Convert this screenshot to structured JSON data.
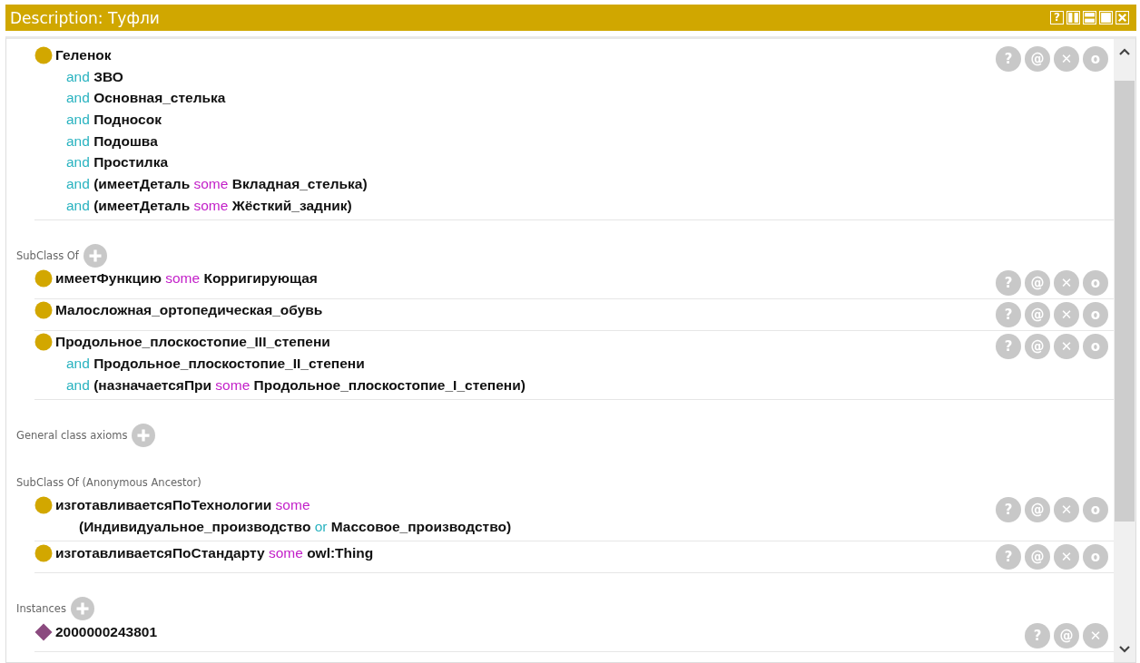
{
  "window": {
    "title": "Description: Туфли",
    "buttons": [
      {
        "kind": "help",
        "text": "?"
      },
      {
        "kind": "split-vertical"
      },
      {
        "kind": "split-horizontal"
      },
      {
        "kind": "maximize"
      },
      {
        "kind": "close"
      }
    ]
  },
  "sections": [
    {
      "entries": [
        {
          "kind": "class",
          "buttons": [
            "?",
            "@",
            "✕",
            "o"
          ],
          "lines": [
            [
              {
                "kind": "name",
                "text": "Геленок"
              }
            ],
            [
              {
                "kind": "and",
                "text": "and"
              },
              {
                "kind": "name",
                "text": "ЗВО"
              }
            ],
            [
              {
                "kind": "and",
                "text": "and"
              },
              {
                "kind": "name",
                "text": "Основная_стелька"
              }
            ],
            [
              {
                "kind": "and",
                "text": "and"
              },
              {
                "kind": "name",
                "text": "Подносок"
              }
            ],
            [
              {
                "kind": "and",
                "text": "and"
              },
              {
                "kind": "name",
                "text": "Подошва"
              }
            ],
            [
              {
                "kind": "and",
                "text": "and"
              },
              {
                "kind": "name",
                "text": "Простилка"
              }
            ],
            [
              {
                "kind": "and",
                "text": "and"
              },
              {
                "kind": "name",
                "text": "(имеетДеталь"
              },
              {
                "kind": "some",
                "text": "some"
              },
              {
                "kind": "name",
                "text": "Вкладная_стелька)"
              }
            ],
            [
              {
                "kind": "and",
                "text": "and"
              },
              {
                "kind": "name",
                "text": "(имеетДеталь"
              },
              {
                "kind": "some",
                "text": "some"
              },
              {
                "kind": "name",
                "text": "Жёсткий_задник)"
              }
            ]
          ]
        }
      ]
    },
    {
      "label": "SubClass Of",
      "add": true,
      "entries": [
        {
          "kind": "class",
          "buttons": [
            "?",
            "@",
            "✕",
            "o"
          ],
          "lines": [
            [
              {
                "kind": "name",
                "text": "имеетФункцию"
              },
              {
                "kind": "some",
                "text": "some"
              },
              {
                "kind": "name",
                "text": "Корригирующая"
              }
            ]
          ]
        },
        {
          "kind": "class",
          "buttons": [
            "?",
            "@",
            "✕",
            "o"
          ],
          "lines": [
            [
              {
                "kind": "name",
                "text": "Малосложная_ортопедическая_обувь"
              }
            ]
          ]
        },
        {
          "kind": "class",
          "buttons": [
            "?",
            "@",
            "✕",
            "o"
          ],
          "lines": [
            [
              {
                "kind": "name",
                "text": "Продольное_плоскостопие_III_степени"
              }
            ],
            [
              {
                "kind": "and",
                "text": "and"
              },
              {
                "kind": "name",
                "text": "Продольное_плоскостопие_II_степени"
              }
            ],
            [
              {
                "kind": "and",
                "text": "and"
              },
              {
                "kind": "name",
                "text": "(назначаетсяПри"
              },
              {
                "kind": "some",
                "text": "some"
              },
              {
                "kind": "name",
                "text": "Продольное_плоскостопие_I_степени)"
              }
            ]
          ]
        }
      ]
    },
    {
      "label": "General class axioms",
      "add": true
    },
    {
      "label": "SubClass Of (Anonymous Ancestor)",
      "add": false,
      "entries": [
        {
          "kind": "class",
          "buttons": [
            "?",
            "@",
            "✕",
            "o"
          ],
          "lines": [
            [
              {
                "kind": "name",
                "text": "изготавливаетсяПоТехнологии"
              },
              {
                "kind": "some",
                "text": "some"
              }
            ],
            [
              {
                "kind": "name",
                "text": "(Индивидуальное_производство"
              },
              {
                "kind": "or",
                "text": "or"
              },
              {
                "kind": "name",
                "text": "Массовое_производство)"
              }
            ]
          ]
        },
        {
          "kind": "class",
          "buttons": [
            "?",
            "@",
            "✕",
            "o"
          ],
          "lines": [
            [
              {
                "kind": "name",
                "text": "изготавливаетсяПоСтандарту"
              },
              {
                "kind": "some",
                "text": "some"
              },
              {
                "kind": "name",
                "text": "owl:Thing"
              }
            ]
          ]
        }
      ]
    },
    {
      "label": "Instances",
      "add": true,
      "entries": [
        {
          "kind": "individual",
          "buttons": [
            "?",
            "@",
            "✕"
          ],
          "lines": [
            [
              {
                "kind": "name",
                "text": "2000000243801"
              }
            ]
          ]
        }
      ]
    }
  ]
}
